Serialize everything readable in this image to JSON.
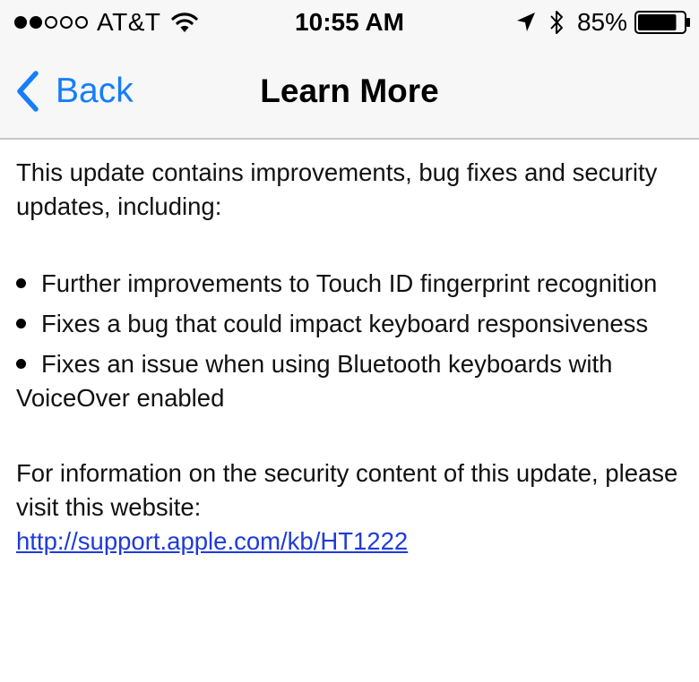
{
  "status_bar": {
    "signal_dots_filled": 2,
    "signal_dots_total": 5,
    "carrier": "AT&T",
    "time": "10:55 AM",
    "battery_percent": "85%",
    "battery_level": 0.85,
    "icons": [
      "wifi-icon",
      "location-arrow-icon",
      "bluetooth-icon",
      "battery-icon"
    ]
  },
  "nav": {
    "back_label": "Back",
    "title": "Learn More"
  },
  "content": {
    "intro": "This update contains improvements, bug fixes and security updates, including:",
    "items": [
      "Further improvements to Touch ID fingerprint recognition",
      "Fixes a bug that could impact keyboard responsiveness",
      "Fixes an issue when using Bluetooth keyboards with VoiceOver enabled"
    ],
    "footer_text": "For information on the security content of this update, please visit this website:",
    "link_text": "http://support.apple.com/kb/HT1222"
  },
  "colors": {
    "accent": "#157efb",
    "link": "#1f3bd8",
    "bar_background": "#f7f7f7"
  }
}
